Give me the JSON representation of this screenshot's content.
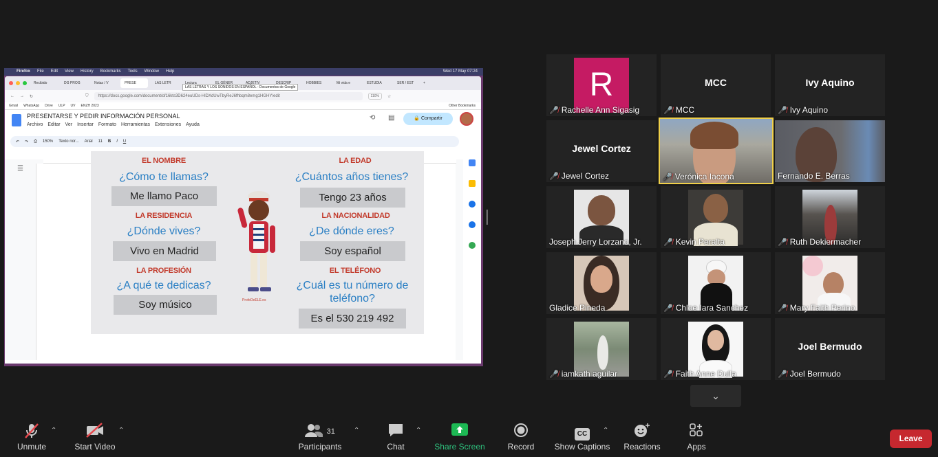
{
  "shared_screen": {
    "mac_menu": [
      "Firefox",
      "File",
      "Edit",
      "View",
      "History",
      "Bookmarks",
      "Tools",
      "Window",
      "Help"
    ],
    "mac_clock": "Wed 17 May  07:24",
    "tabs": [
      "Recibido",
      "DG PROG",
      "Notas / V",
      "PRESE",
      "LAS LETR",
      "Lectura",
      "EL GÉNER",
      "ADJETIV",
      "DESCRIP",
      "HOBBIES",
      "Mi vida e",
      "ESTUDIA",
      "SER / EST"
    ],
    "tab_tooltip": "LAS LETRAS Y LOS SONIDOS EN ESPAÑOL - Documentos de Google",
    "url": "https://docs.google.com/document/d/16kts3D624euUDs-HlDXdUwTbyReJ6fhbqm8emg1HGHY/edit",
    "zoom_pct": "110%",
    "bookmarks": [
      "Gmail",
      "WhatsApp",
      "Drive",
      "ULP",
      "UV",
      "ENZH 2023"
    ],
    "bookmarks_other": "Other Bookmarks",
    "doc_title": "PRESENTARSE Y PEDIR INFORMACIÓN PERSONAL",
    "doc_menu": [
      "Archivo",
      "Editar",
      "Ver",
      "Insertar",
      "Formato",
      "Herramientas",
      "Extensiones",
      "Ayuda"
    ],
    "share_button": "Compartir",
    "toolbar": {
      "zoom": "150%",
      "style": "Texto nor...",
      "font": "Arial",
      "size": "11"
    },
    "infographic": {
      "blocks": [
        {
          "heading": "EL NOMBRE",
          "question": "¿Cómo te llamas?",
          "answer": "Me llamo Paco"
        },
        {
          "heading": "LA EDAD",
          "question": "¿Cuántos años tienes?",
          "answer": "Tengo 23 años"
        },
        {
          "heading": "LA RESIDENCIA",
          "question": "¿Dónde vives?",
          "answer": "Vivo en Madrid"
        },
        {
          "heading": "LA NACIONALIDAD",
          "question": "¿De dónde eres?",
          "answer": "Soy español"
        },
        {
          "heading": "LA PROFESIÓN",
          "question": "¿A qué te dedicas?",
          "answer": "Soy músico"
        },
        {
          "heading": "EL TELÉFONO",
          "question": "¿Cuál es tu número de teléfono?",
          "answer": "Es el 530 219 492"
        }
      ],
      "watermark": "ProfeDeELE.es"
    }
  },
  "participants": [
    {
      "name": "Rachelle Ann Sigasig",
      "avatar": "R",
      "muted": true
    },
    {
      "name": "MCC",
      "big": "MCC",
      "muted": true
    },
    {
      "name": "Ivy Aquino",
      "big": "Ivy Aquino",
      "muted": true
    },
    {
      "name": "Jewel Cortez",
      "big": "Jewel Cortez",
      "muted": true
    },
    {
      "name": "Verónica Iacona",
      "muted": true,
      "speaking": true
    },
    {
      "name": "Fernando E. Berras",
      "muted": false
    },
    {
      "name": "Joseph Jerry Lorzano, Jr.",
      "muted": false
    },
    {
      "name": "Kevin Peralta",
      "muted": true
    },
    {
      "name": "Ruth Dekiermacher",
      "muted": true
    },
    {
      "name": "Gladice Pineda",
      "muted": false
    },
    {
      "name": "Chloe Iara Sanchez",
      "muted": true
    },
    {
      "name": "Mary Faith Perino",
      "muted": true
    },
    {
      "name": "iamkath aguilar",
      "muted": true
    },
    {
      "name": "Faith Anne Dulla",
      "muted": true
    },
    {
      "name": "Joel Bermudo",
      "big": "Joel Bermudo",
      "muted": true
    }
  ],
  "toolbar": {
    "unmute": "Unmute",
    "start_video": "Start Video",
    "participants": "Participants",
    "participants_count": "31",
    "chat": "Chat",
    "share_screen": "Share Screen",
    "record": "Record",
    "show_captions": "Show Captions",
    "reactions": "Reactions",
    "apps": "Apps",
    "leave": "Leave",
    "cc_badge": "CC"
  },
  "colors": {
    "leave_red": "#c6282f",
    "share_green": "#1db954",
    "speaker_border": "#f0d04a",
    "mute_red": "#e5484d"
  }
}
